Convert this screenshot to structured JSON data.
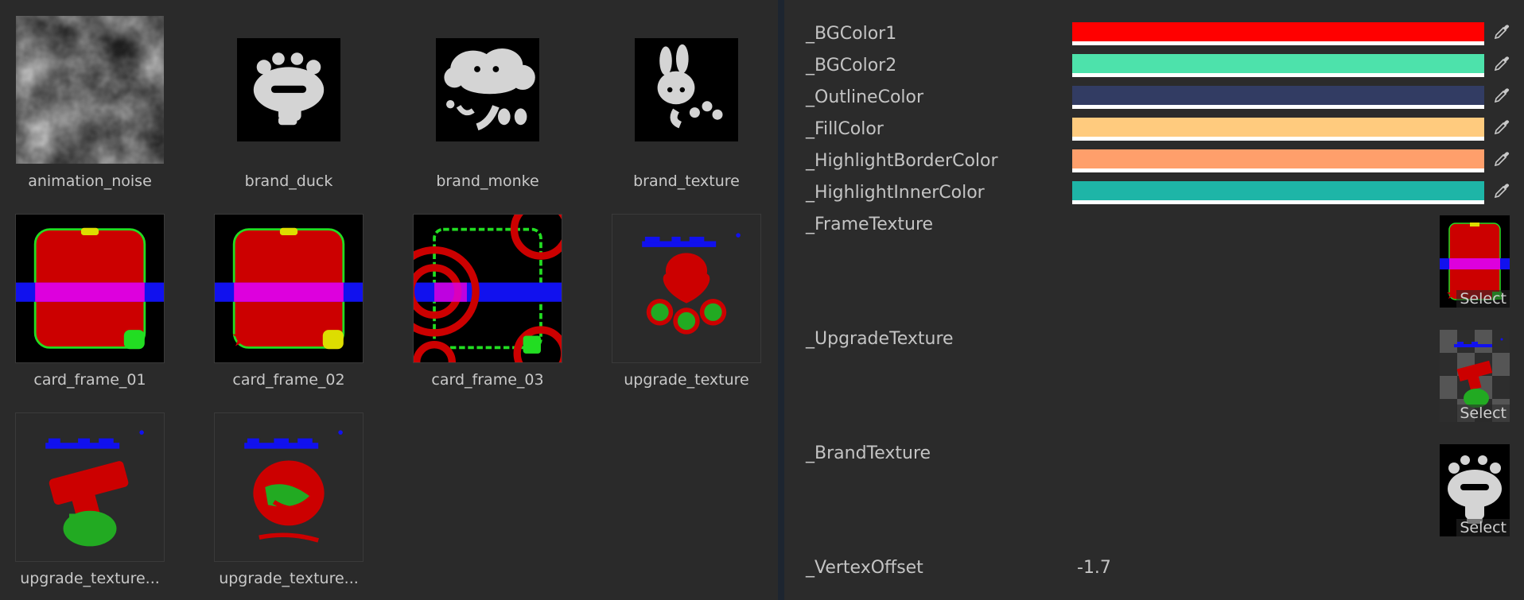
{
  "assets": [
    {
      "label": "animation_noise",
      "thumb": "noise"
    },
    {
      "label": "brand_duck",
      "thumb": "duck"
    },
    {
      "label": "brand_monke",
      "thumb": "monke"
    },
    {
      "label": "brand_texture",
      "thumb": "bunny"
    },
    {
      "label": "card_frame_01",
      "thumb": "frame1"
    },
    {
      "label": "card_frame_02",
      "thumb": "frame2"
    },
    {
      "label": "card_frame_03",
      "thumb": "frame3"
    },
    {
      "label": "upgrade_texture",
      "thumb": "upgrade"
    },
    {
      "label": "upgrade_texture...",
      "thumb": "upgrade2"
    },
    {
      "label": "upgrade_texture...",
      "thumb": "upgrade3"
    }
  ],
  "inspector": {
    "color_props": [
      {
        "label": "_BGColor1",
        "color": "#ff0000"
      },
      {
        "label": "_BGColor2",
        "color": "#4de2ab"
      },
      {
        "label": "_OutlineColor",
        "color": "#323c63"
      },
      {
        "label": "_FillColor",
        "color": "#ffcb7e"
      },
      {
        "label": "_HighlightBorderColor",
        "color": "#ff9f6b"
      },
      {
        "label": "_HighlightInnerColor",
        "color": "#1eb5a7"
      }
    ],
    "texture_props": [
      {
        "label": "_FrameTexture",
        "select": "Select"
      },
      {
        "label": "_UpgradeTexture",
        "select": "Select"
      },
      {
        "label": "_BrandTexture",
        "select": "Select"
      }
    ],
    "float_props": [
      {
        "label": "_VertexOffset",
        "value": "-1.7"
      }
    ]
  }
}
